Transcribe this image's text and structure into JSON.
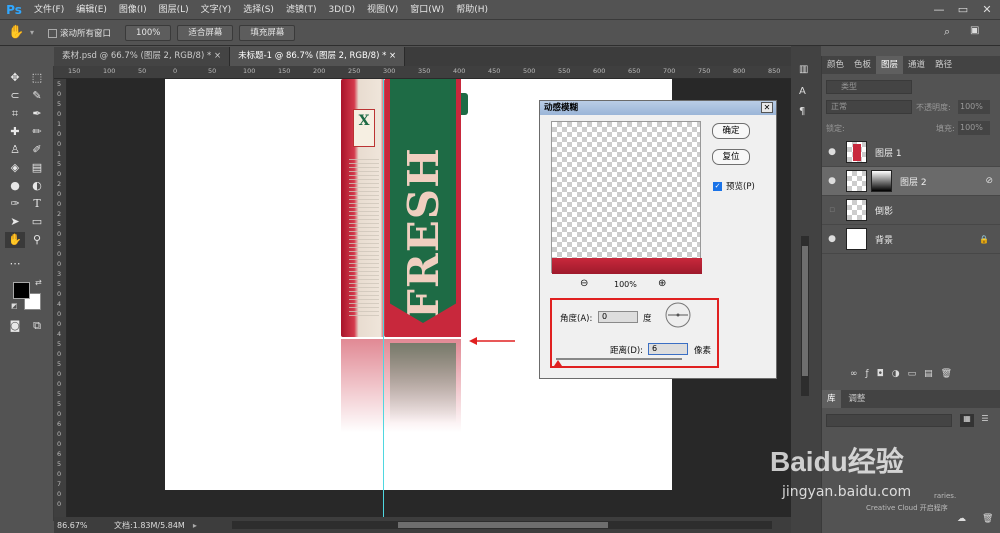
{
  "app": {
    "logo": "Ps"
  },
  "menu": [
    "文件(F)",
    "编辑(E)",
    "图像(I)",
    "图层(L)",
    "文字(Y)",
    "选择(S)",
    "滤镜(T)",
    "3D(D)",
    "视图(V)",
    "窗口(W)",
    "帮助(H)"
  ],
  "window_controls": {
    "minimize": "—",
    "restore": "▭",
    "close": "✕"
  },
  "options": {
    "scroll_all_label": "滚动所有窗口",
    "zoom_100": "100%",
    "fit_screen": "适合屏幕",
    "fill_screen": "填充屏幕"
  },
  "tabs": [
    {
      "label": "素材.psd @ 66.7% (图层 2, RGB/8) *",
      "active": false
    },
    {
      "label": "未标题-1 @ 86.7% (图层 2, RGB/8) *",
      "active": true
    }
  ],
  "ruler_h": [
    "150",
    "100",
    "50",
    "0",
    "50",
    "100",
    "150",
    "200",
    "250",
    "300",
    "350",
    "400",
    "450",
    "500",
    "550",
    "600",
    "650",
    "700",
    "750",
    "800",
    "850"
  ],
  "ruler_v": [
    "5",
    "0",
    "5",
    "0",
    "1",
    "0",
    "0",
    "1",
    "5",
    "0",
    "2",
    "0",
    "0",
    "2",
    "5",
    "0",
    "3",
    "0",
    "0",
    "3",
    "5",
    "0",
    "4",
    "0",
    "0",
    "4",
    "5",
    "0",
    "5",
    "0",
    "0",
    "5",
    "5",
    "0",
    "6",
    "0",
    "0",
    "6",
    "5",
    "0",
    "7",
    "0",
    "0"
  ],
  "package": {
    "brand": "FRESH",
    "badge": "X"
  },
  "status": {
    "zoom": "86.67%",
    "doc": "文档:1.83M/5.84M"
  },
  "dialog": {
    "title": "动感模糊",
    "ok": "确定",
    "reset": "复位",
    "preview_label": "预览(P)",
    "zoom_pct": "100%",
    "angle_label": "角度(A):",
    "angle_value": "0",
    "angle_unit": "度",
    "distance_label": "距离(D):",
    "distance_value": "6",
    "distance_unit": "像素"
  },
  "panels": {
    "top_tabs": [
      "颜色",
      "色板",
      "图层",
      "通道",
      "路径"
    ],
    "kind_label": "类型",
    "blend_mode": "正常",
    "opacity_label": "不透明度:",
    "opacity_value": "100%",
    "lock_label": "锁定:",
    "fill_label": "填充:",
    "fill_value": "100%",
    "layers": [
      {
        "name": "图层 1",
        "selected": false
      },
      {
        "name": "图层 2",
        "selected": true
      },
      {
        "name": "倒影",
        "selected": false
      },
      {
        "name": "背景",
        "selected": false
      }
    ],
    "lib_tabs": [
      "库",
      "调整"
    ],
    "cc_text": "Creative Cloud 开启程序",
    "lib_hint": "raries."
  },
  "watermark": {
    "brand": "Baidu经验",
    "url": "jingyan.baidu.com"
  },
  "colors": {
    "accent_red": "#e02020",
    "ps_blue": "#31a8ff",
    "package_red": "#c8283c",
    "package_green": "#1e6b45"
  }
}
